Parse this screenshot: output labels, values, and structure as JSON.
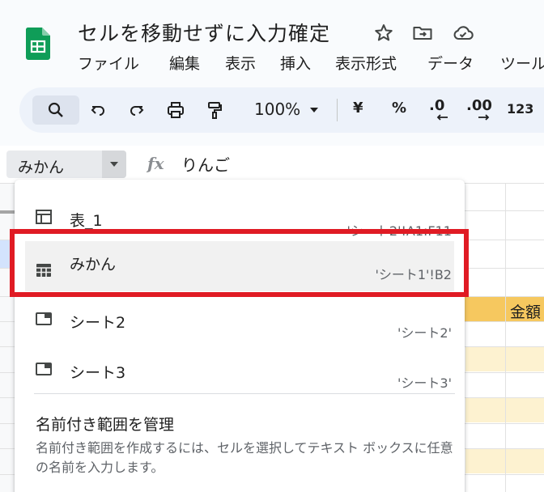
{
  "document": {
    "title": "セルを移動せずに入力確定"
  },
  "menu": {
    "items": [
      "ファイル",
      "編集",
      "表示",
      "挿入",
      "表示形式",
      "データ",
      "ツール"
    ]
  },
  "toolbar": {
    "zoom": "100%",
    "currency": "¥",
    "percent": "%",
    "decrease_decimal": ".0",
    "increase_decimal": ".00",
    "number_format": "123"
  },
  "formula_bar": {
    "name_box_value": "みかん",
    "fx_label": "fx",
    "formula_value": "りんご"
  },
  "grid": {
    "header_cell_text": "金額"
  },
  "named_ranges": {
    "items": [
      {
        "label": "表_1",
        "range": "'シート2'!A1:F11",
        "icon": "table-icon"
      },
      {
        "label": "みかん",
        "range": "'シート1'!B2",
        "icon": "named-range-icon",
        "selected": true
      },
      {
        "label": "シート2",
        "range": "'シート2'",
        "icon": "sheet-icon"
      },
      {
        "label": "シート3",
        "range": "'シート3'",
        "icon": "sheet-icon"
      }
    ],
    "manage_title": "名前付き範囲を管理",
    "manage_description": "名前付き範囲を作成するには、セルを選択してテキスト ボックスに任意の名前を入力します。"
  },
  "colors": {
    "highlight": "#e01b24",
    "sheets_green": "#0f9d58",
    "header_yellow": "#f6c85f",
    "row_yellow": "#fdf2d0"
  }
}
